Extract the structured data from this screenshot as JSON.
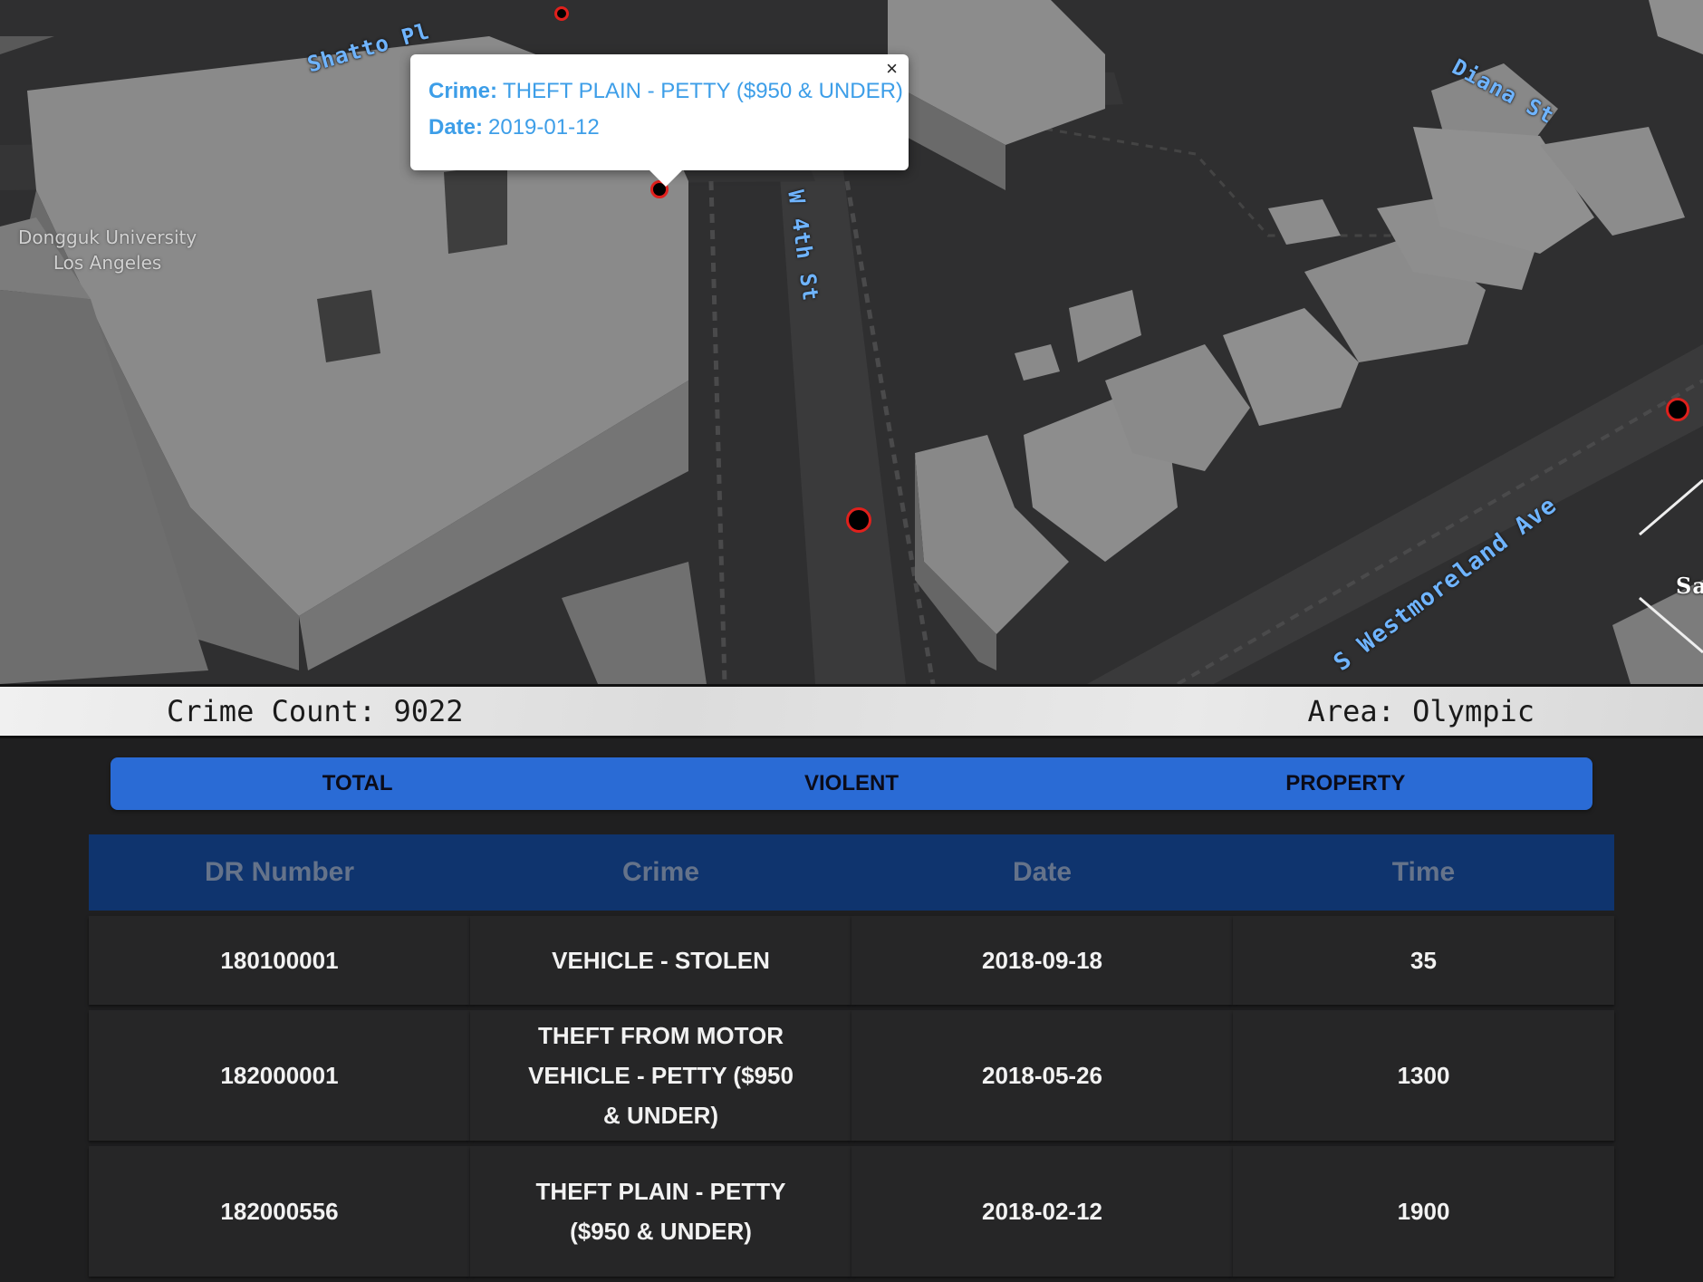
{
  "map": {
    "streets": {
      "shatto": "Shatto Pl",
      "w4th": "W 4th St",
      "diana": "Diana St",
      "westmoreland": "S Westmoreland Ave",
      "edge": "Sa"
    },
    "poi": {
      "line1": "Dongguk University",
      "line2": "Los Angeles"
    },
    "popup": {
      "crime_label": "Crime:",
      "crime_value": "THEFT PLAIN - PETTY ($950 & UNDER)",
      "date_label": "Date:",
      "date_value": "2019-01-12",
      "close": "×"
    },
    "marker_color": "#e0201c"
  },
  "info_bar": {
    "crime_count": "Crime Count: 9022",
    "area": "Area: Olympic"
  },
  "tabs": [
    {
      "label": "TOTAL"
    },
    {
      "label": "VIOLENT"
    },
    {
      "label": "PROPERTY"
    }
  ],
  "table": {
    "headers": [
      "DR Number",
      "Crime",
      "Date",
      "Time"
    ],
    "rows": [
      {
        "dr": "180100001",
        "crime": "VEHICLE - STOLEN",
        "date": "2018-09-18",
        "time": "35"
      },
      {
        "dr": "182000001",
        "crime": "THEFT FROM MOTOR VEHICLE - PETTY ($950 & UNDER)",
        "date": "2018-05-26",
        "time": "1300"
      },
      {
        "dr": "182000556",
        "crime": "THEFT PLAIN - PETTY ($950 & UNDER)",
        "date": "2018-02-12",
        "time": "1900"
      }
    ]
  },
  "colors": {
    "tab_bar": "#2a6bd5",
    "table_header": "#0f346e",
    "popup_text": "#3d9ee8",
    "street_label": "#6fb4ff"
  }
}
